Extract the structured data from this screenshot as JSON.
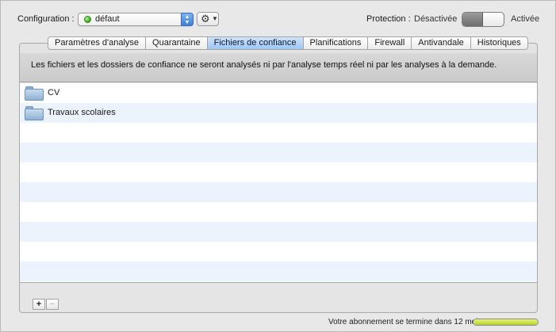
{
  "config": {
    "label": "Configuration :",
    "value": "défaut",
    "status_color": "#3aa419"
  },
  "toolbar": {
    "gear_icon": "gear-icon"
  },
  "protection": {
    "label": "Protection :",
    "off_label": "Désactivée",
    "on_label": "Activée",
    "state": "off"
  },
  "tabs": [
    {
      "label": "Paramètres d'analyse",
      "active": false
    },
    {
      "label": "Quarantaine",
      "active": false
    },
    {
      "label": "Fichiers de confiance",
      "active": true
    },
    {
      "label": "Planifications",
      "active": false
    },
    {
      "label": "Firewall",
      "active": false
    },
    {
      "label": "Antivandale",
      "active": false
    },
    {
      "label": "Historiques",
      "active": false
    }
  ],
  "info": {
    "text": "Les fichiers et les dossiers de confiance ne seront analysés ni par l'analyse temps réel ni par les analyses à la demande."
  },
  "trusted_items": [
    {
      "name": "CV",
      "icon": "folder-icon"
    },
    {
      "name": "Travaux scolaires",
      "icon": "folder-icon"
    }
  ],
  "list_actions": {
    "add_label": "+",
    "remove_label": "−"
  },
  "subscription": {
    "text": "Votre abonnement se termine dans 12 mois",
    "bar_color": "#c7e03b",
    "progress_fraction": 1.0
  }
}
